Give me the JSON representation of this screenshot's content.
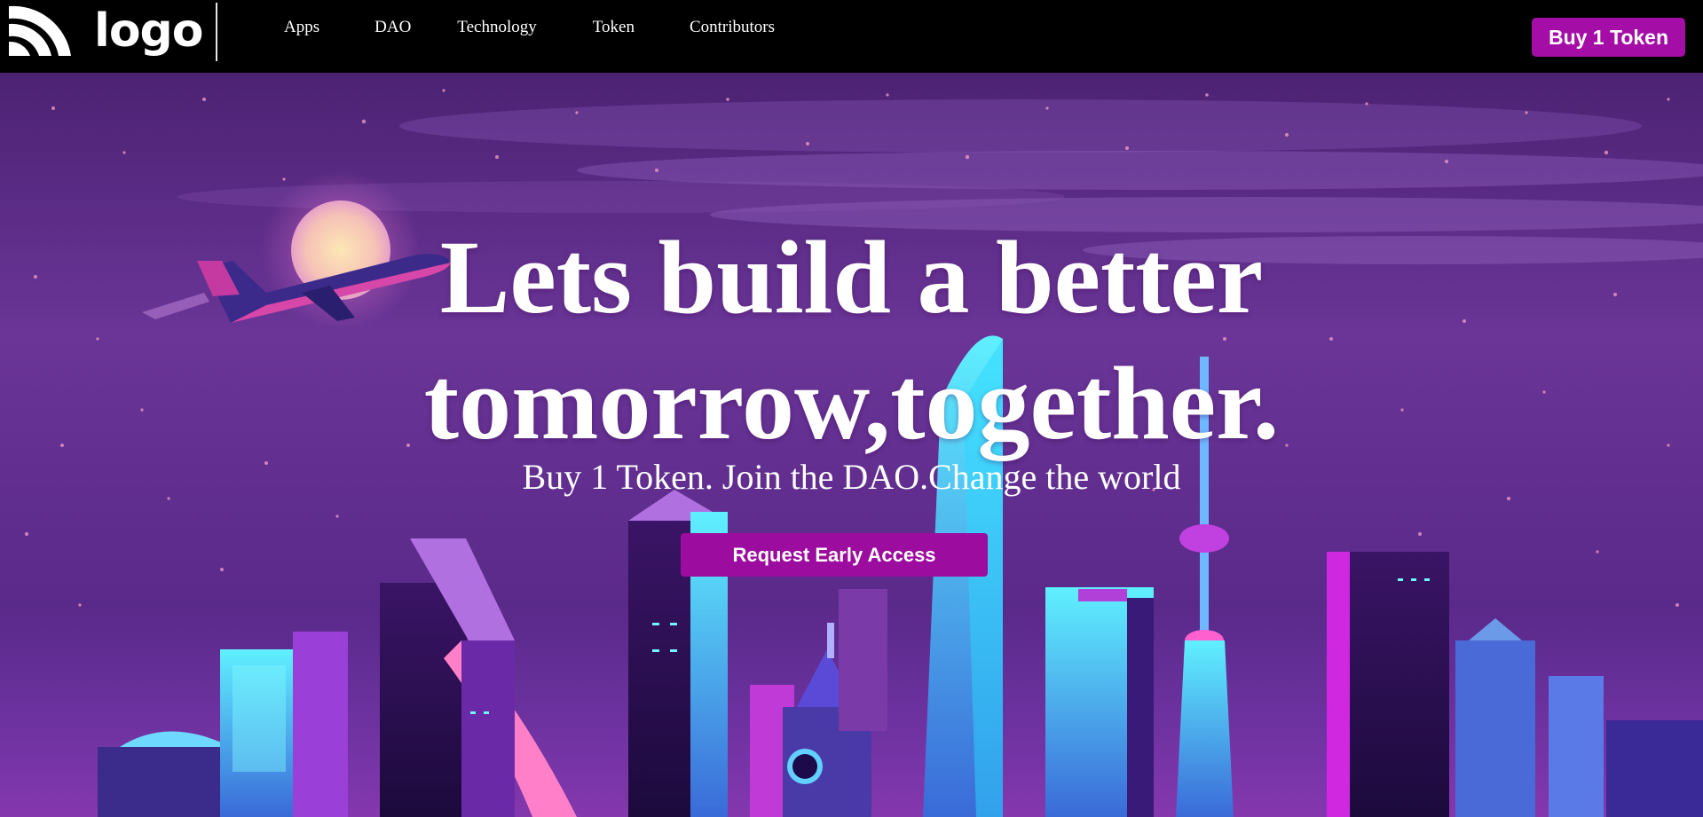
{
  "header": {
    "logo_text": "logo",
    "nav": [
      {
        "label": "Apps"
      },
      {
        "label": "DAO"
      },
      {
        "label": "Technology"
      },
      {
        "label": "Token"
      },
      {
        "label": "Contributors"
      }
    ],
    "cta_label": "Buy 1 Token"
  },
  "hero": {
    "headline_line1": "Lets build a better",
    "headline_line2": "tomorrow,together.",
    "subheadline": "Buy 1 Token. Join the DAO.Change the world",
    "cta_label": "Request Early Access"
  },
  "colors": {
    "accent": "#a50ea6",
    "nav_bg": "#000000",
    "sky": "#5a2a8c"
  },
  "icons": {
    "logo": "rss-arc-icon"
  }
}
